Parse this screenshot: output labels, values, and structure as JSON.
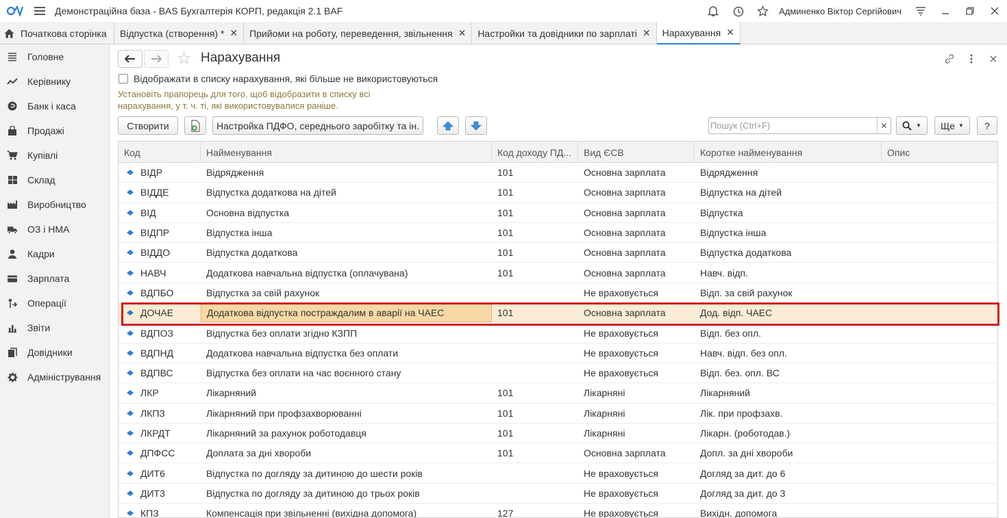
{
  "app": {
    "title": "Демонстраційна база - BAS Бухгалтерія КОРП, редакція 2.1 BAF",
    "user": "Админенко Віктор Сергійович"
  },
  "tabs": [
    {
      "label": "Початкова сторінка",
      "closable": false
    },
    {
      "label": "Відпустка (створення) *",
      "closable": true
    },
    {
      "label": "Прийоми на роботу, переведення, звільнення",
      "closable": true
    },
    {
      "label": "Настройки та довідники по зарплаті",
      "closable": true
    },
    {
      "label": "Нарахування",
      "closable": true,
      "active": true
    }
  ],
  "sidebar": {
    "items": [
      {
        "label": "Головне",
        "icon": "menu-icon"
      },
      {
        "label": "Керівнику",
        "icon": "trend-icon"
      },
      {
        "label": "Банк і каса",
        "icon": "coin-icon"
      },
      {
        "label": "Продажі",
        "icon": "bag-icon"
      },
      {
        "label": "Купівлі",
        "icon": "cart-icon"
      },
      {
        "label": "Склад",
        "icon": "warehouse-icon"
      },
      {
        "label": "Виробництво",
        "icon": "factory-icon"
      },
      {
        "label": "ОЗ і НМА",
        "icon": "truck-icon"
      },
      {
        "label": "Кадри",
        "icon": "person-icon"
      },
      {
        "label": "Зарплата",
        "icon": "wallet-icon"
      },
      {
        "label": "Операції",
        "icon": "operations-icon"
      },
      {
        "label": "Звіти",
        "icon": "bar-chart-icon"
      },
      {
        "label": "Довідники",
        "icon": "books-icon"
      },
      {
        "label": "Адміністрування",
        "icon": "gear-icon"
      }
    ]
  },
  "form": {
    "title": "Нарахування",
    "checkbox_label": "Відображати в списку нарахування, які більше не використовуються",
    "hint": "Установіть прапорець для того, щоб відобразити в списку всі нарахування, у т. ч. ті, які використовувалися раніше.",
    "create_label": "Створити",
    "settings_label": "Настройка ПДФО, середнього заробітку та ін.",
    "search_placeholder": "Пошук (Ctrl+F)",
    "more_label": "Ще",
    "help_label": "?"
  },
  "table": {
    "columns": [
      "Код",
      "Найменування",
      "Код доходу ПД...",
      "Вид ЄСВ",
      "Коротке найменування",
      "Опис"
    ],
    "rows": [
      {
        "code": "ВІДР",
        "name": "Відрядження",
        "income": "101",
        "esv": "Основна зарплата",
        "short": "Відрядження",
        "desc": ""
      },
      {
        "code": "ВІДДЕ",
        "name": "Відпустка додаткова на дітей",
        "income": "101",
        "esv": "Основна зарплата",
        "short": "Відпустка на дітей",
        "desc": ""
      },
      {
        "code": "ВІД",
        "name": "Основна відпустка",
        "income": "101",
        "esv": "Основна зарплата",
        "short": "Відпустка",
        "desc": ""
      },
      {
        "code": "ВІДПР",
        "name": "Відпустка інша",
        "income": "101",
        "esv": "Основна зарплата",
        "short": "Відпустка інша",
        "desc": ""
      },
      {
        "code": "ВІДДО",
        "name": "Відпустка додаткова",
        "income": "101",
        "esv": "Основна зарплата",
        "short": "Відпустка додаткова",
        "desc": ""
      },
      {
        "code": "НАВЧ",
        "name": "Додаткова навчальна відпустка (оплачувана)",
        "income": "101",
        "esv": "Основна зарплата",
        "short": "Навч. відп.",
        "desc": ""
      },
      {
        "code": "ВДПБО",
        "name": "Відпустка за свій рахунок",
        "income": "",
        "esv": "Не враховується",
        "short": "Відп. за свій рахунок",
        "desc": ""
      },
      {
        "code": "ДОЧАЕ",
        "name": "Додаткова відпустка постраждалим в аварії на ЧАЕС",
        "income": "101",
        "esv": "Основна зарплата",
        "short": "Дод. відп. ЧАЕС",
        "desc": "",
        "selected": true
      },
      {
        "code": "ВДПОЗ",
        "name": "Відпустка без оплати згідно КЗПП",
        "income": "",
        "esv": "Не враховується",
        "short": "Відп. без опл.",
        "desc": ""
      },
      {
        "code": "ВДПНД",
        "name": "Додаткова навчальна відпустка без оплати",
        "income": "",
        "esv": "Не враховується",
        "short": "Навч. відп. без опл.",
        "desc": ""
      },
      {
        "code": "ВДПВС",
        "name": "Відпустка без оплати на час воєнного стану",
        "income": "",
        "esv": "Не враховується",
        "short": "Відп. без. опл. ВС",
        "desc": ""
      },
      {
        "code": "ЛКР",
        "name": "Лікарняний",
        "income": "101",
        "esv": "Лікарняні",
        "short": "Лікарняний",
        "desc": ""
      },
      {
        "code": "ЛКПЗ",
        "name": "Лікарняний при профзахворюванні",
        "income": "101",
        "esv": "Лікарняні",
        "short": "Лік. при профзахв.",
        "desc": ""
      },
      {
        "code": "ЛКРДТ",
        "name": "Лікарняний за рахунок роботодавця",
        "income": "101",
        "esv": "Лікарняні",
        "short": "Лікарн. (роботодав.)",
        "desc": ""
      },
      {
        "code": "ДПФСС",
        "name": "Доплата за дні хвороби",
        "income": "101",
        "esv": "Основна зарплата",
        "short": "Допл. за дні хвороби",
        "desc": ""
      },
      {
        "code": "ДИТ6",
        "name": "Відпустка по догляду за дитиною до шести років",
        "income": "",
        "esv": "Не враховується",
        "short": "Догляд за дит. до 6",
        "desc": ""
      },
      {
        "code": "ДИТ3",
        "name": "Відпустка по догляду за дитиною до трьох років",
        "income": "",
        "esv": "Не враховується",
        "short": "Догляд за дит. до 3",
        "desc": ""
      },
      {
        "code": "КПЗ",
        "name": "Компенсація при звільненні (вихідна допомога)",
        "income": "127",
        "esv": "Не враховується",
        "short": "Вихідн. допомога",
        "desc": ""
      }
    ]
  },
  "colors": {
    "accent": "#2b7fd4",
    "selected_row": "#fbecd5",
    "highlight": "#d21818",
    "hint": "#8a7a3a"
  }
}
